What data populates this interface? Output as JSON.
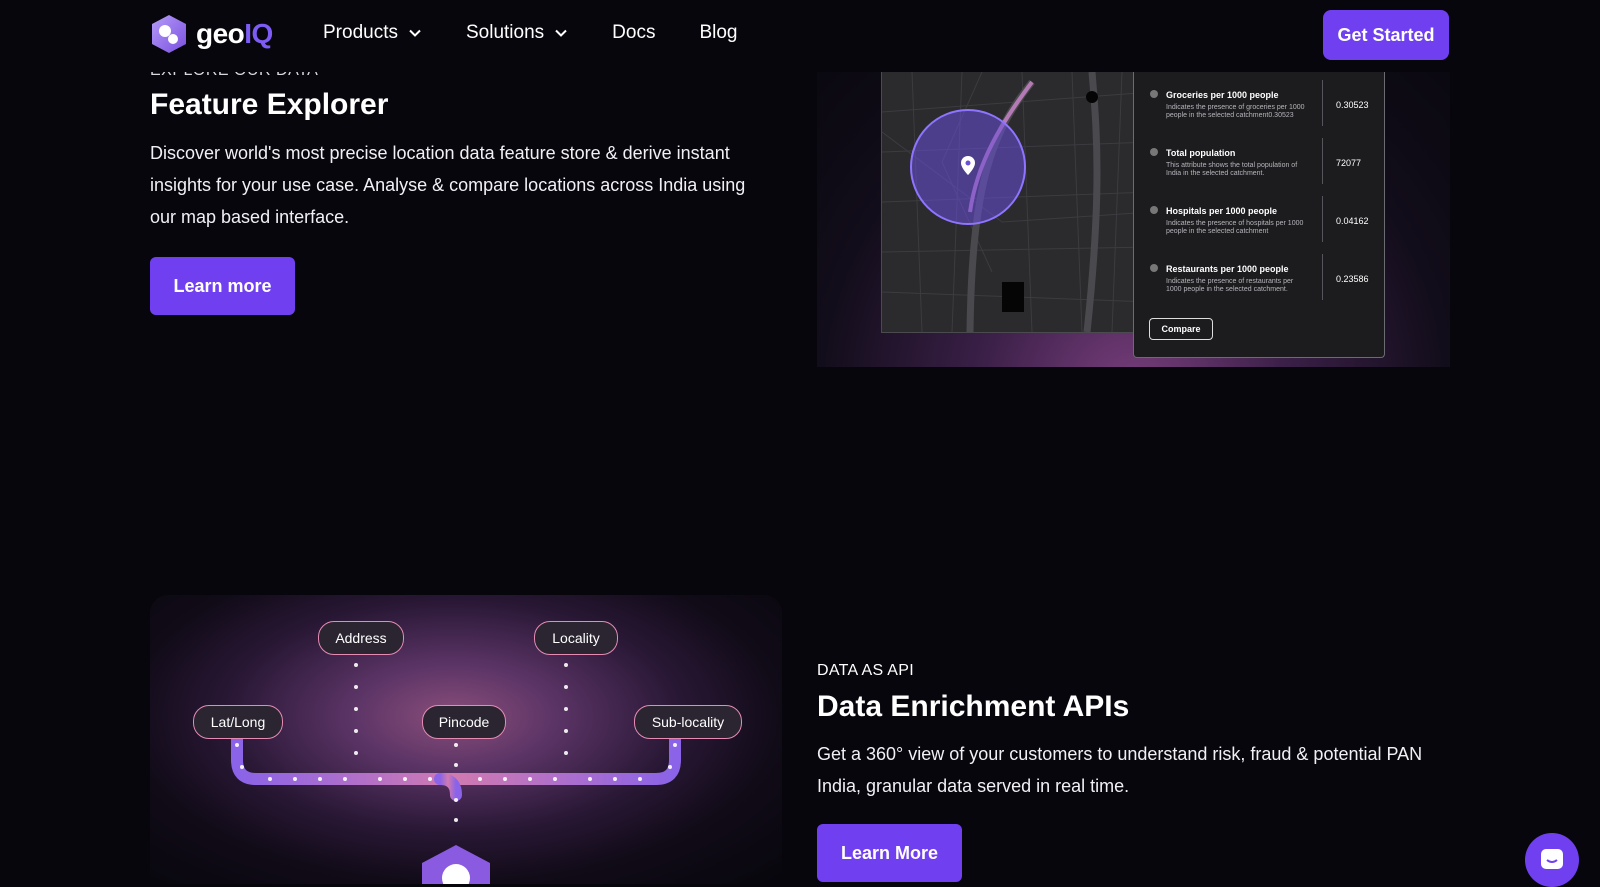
{
  "nav": {
    "logo_geo": "geo",
    "logo_iq": "IQ",
    "items": [
      {
        "label": "Products",
        "dropdown": true
      },
      {
        "label": "Solutions",
        "dropdown": true
      },
      {
        "label": "Docs",
        "dropdown": false
      },
      {
        "label": "Blog",
        "dropdown": false
      }
    ],
    "cta": "Get Started"
  },
  "feature_explorer": {
    "eyebrow": "EXPLORE OUR DATA",
    "title": "Feature Explorer",
    "description": "Discover world's most precise location data feature store & derive instant insights for your use case. Analyse & compare locations across India using our map based interface.",
    "button": "Learn more",
    "panel": {
      "metrics": [
        {
          "title": "Groceries per 1000 people",
          "desc": "Indicates the presence of groceries per 1000 people in the selected catchment0.30523",
          "value": "0.30523"
        },
        {
          "title": "Total population",
          "desc": "This attribute shows the total population of India in the selected catchment.",
          "value": "72077"
        },
        {
          "title": "Hospitals per 1000 people",
          "desc": "Indicates the presence of hospitals per 1000 people in the selected catchment",
          "value": "0.04162"
        },
        {
          "title": "Restaurants per 1000 people",
          "desc": "Indicates the presence of restaurants per 1000 people in the selected catchment.",
          "value": "0.23586"
        }
      ],
      "compare": "Compare"
    }
  },
  "data_api": {
    "eyebrow": "DATA AS API",
    "title": "Data Enrichment APIs",
    "description": "Get a 360° view of your customers to understand risk, fraud & potential PAN India, granular data served in real time.",
    "button": "Learn More",
    "pills": {
      "address": "Address",
      "locality": "Locality",
      "latlong": "Lat/Long",
      "pincode": "Pincode",
      "sublocality": "Sub-locality"
    }
  },
  "colors": {
    "accent": "#7040f0",
    "background": "#07060c",
    "pill_border": "#e58bb4"
  }
}
